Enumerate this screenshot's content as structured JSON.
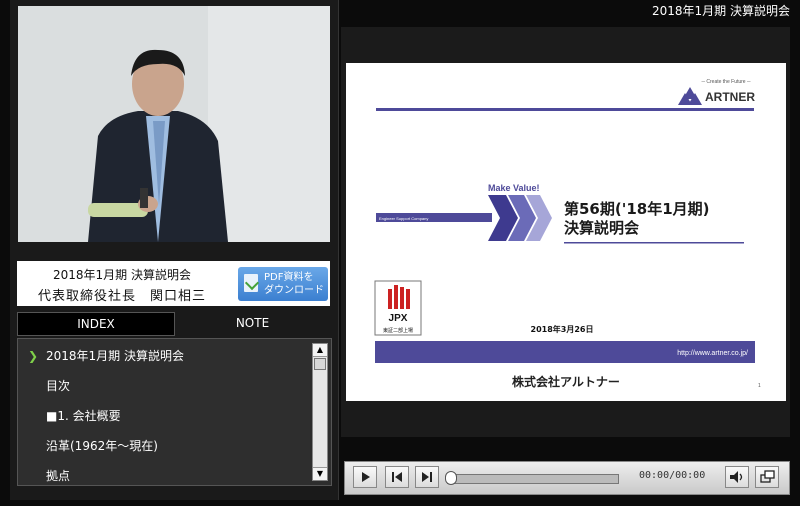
{
  "window": {
    "title": "2018年1月期 決算説明会"
  },
  "presenter": {
    "event": "2018年1月期 決算説明会",
    "name": "代表取締役社長　関口相三"
  },
  "pdf_button": {
    "line1": "PDF資料を",
    "line2": "ダウンロード"
  },
  "tabs": [
    {
      "label": "INDEX",
      "active": true
    },
    {
      "label": "NOTE",
      "active": false
    }
  ],
  "index_items": [
    {
      "label": "2018年1月期 決算説明会",
      "current": true
    },
    {
      "label": "目次"
    },
    {
      "label": "■1. 会社概要"
    },
    {
      "label": "沿革(1962年～現在)"
    },
    {
      "label": "拠点"
    }
  ],
  "slide": {
    "logo_tagline": "─ Create the Future ─",
    "logo_text": "ARTNER",
    "make_value": "Make Value!",
    "company_tag": "Engineer Support Company",
    "heading1": "第56期('18年1月期)",
    "heading2": "決算説明会",
    "jpx_label": "JPX",
    "jpx_sub": "東証二部上場",
    "date": "2018年3月26日",
    "url": "http://www.artner.co.jp/",
    "company": "株式会社アルトナー",
    "page": "1"
  },
  "player": {
    "time": "00:00/00:00"
  },
  "colors": {
    "accent_green": "#7fd04a",
    "slide_purple": "#4e4a99",
    "pdf_blue": "#3b7fd0"
  }
}
